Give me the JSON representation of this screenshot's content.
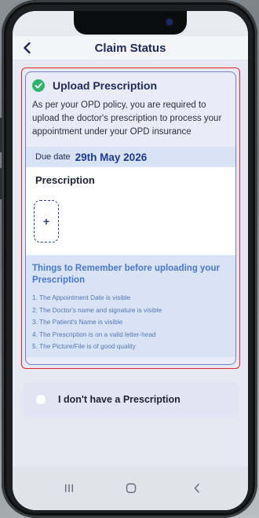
{
  "header": {
    "title": "Claim Status",
    "back_icon": "chevron-left-icon"
  },
  "card": {
    "title": "Upload Prescription",
    "check_icon": "check-circle-icon",
    "check_color": "#2db36a",
    "description": "As per your OPD policy, you are required to upload the doctor's prescription to process your appointment under your OPD insurance",
    "due_label": "Due date",
    "due_date": "29th May 2026",
    "prescription_label": "Prescription",
    "upload_symbol": "+",
    "things_title": "Things to Remember before uploading your Prescription",
    "things": [
      "1. The Appointment Date is visible",
      "2. The Doctor's name and signature is visible",
      "3. The Patient's Name is visible",
      "4. The Prescription is on a valid letter-head",
      "5. The Picture/File is of good quality"
    ]
  },
  "option": {
    "label": "I don't have a Prescription",
    "selected": false
  },
  "navbar": {
    "icons": [
      "recent-apps-icon",
      "home-icon",
      "back-icon"
    ]
  },
  "colors": {
    "accent": "#1f2a57",
    "highlight_border": "#e0262f",
    "link_blue": "#4a77c9"
  }
}
